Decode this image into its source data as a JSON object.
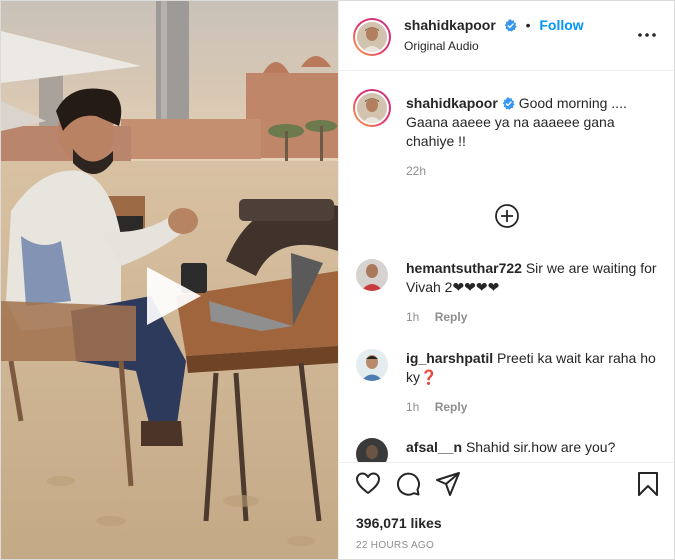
{
  "post": {
    "author": "shahidkapoor",
    "audio": "Original Audio",
    "follow_label": "Follow",
    "caption_author": "shahidkapoor",
    "caption_text": "Good morning .... Gaana aaeee ya na aaaeee gana chahiye !!",
    "caption_time": "22h",
    "likes": "396,071 likes",
    "posted_ago": "22 HOURS AGO"
  },
  "comments": [
    {
      "user": "hemantsuthar722",
      "text": "Sir we are waiting for Vivah 2❤❤❤❤",
      "time": "1h",
      "reply": "Reply"
    },
    {
      "user": "ig_harshpatil",
      "text": "Preeti ka wait kar raha ho ky❓",
      "time": "1h",
      "reply": "Reply"
    },
    {
      "user": "afsal__n",
      "text": "Shahid sir.how are you?",
      "time": "",
      "reply": ""
    }
  ],
  "colors": {
    "follow": "#0095f6",
    "verified": "#3897f0",
    "muted": "#8e8e8e",
    "border": "#efefef"
  },
  "icons": {
    "play": "play-icon",
    "more": "more-options-icon",
    "add": "add-comment-icon",
    "like": "heart-icon",
    "comment": "comment-icon",
    "share": "share-icon",
    "save": "bookmark-icon"
  }
}
